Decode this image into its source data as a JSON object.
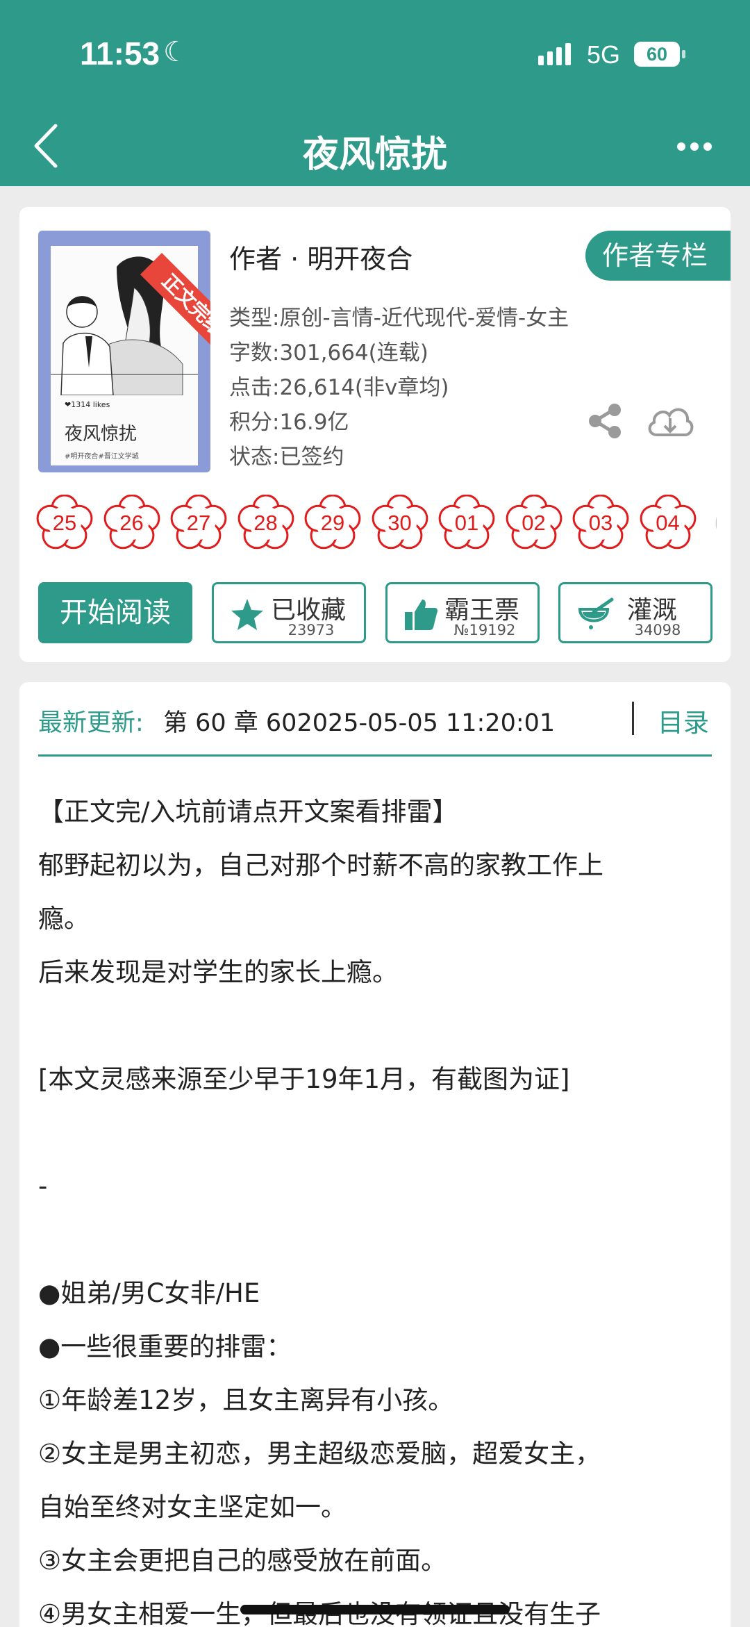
{
  "status_bar": {
    "time": "11:53",
    "network": "5G",
    "battery": "60"
  },
  "nav": {
    "title": "夜风惊扰"
  },
  "book": {
    "cover": {
      "ribbon": "正文完结",
      "title": "夜风惊扰",
      "likes": "❤1314 likes",
      "tags": "#明开夜合#晋江文学城"
    },
    "author": "作者 · 明开夜合",
    "author_column_button": "作者专栏",
    "meta": [
      "类型:原创-言情-近代现代-爱情-女主",
      "字数:301,664(连载)",
      "点击:26,614(非v章均)",
      "积分:16.9亿",
      "状态:已签约"
    ],
    "icons": [
      "share-icon",
      "download-icon"
    ]
  },
  "dates": [
    "25",
    "26",
    "27",
    "28",
    "29",
    "30",
    "01",
    "02",
    "03",
    "04"
  ],
  "actions": {
    "start_reading": "开始阅读",
    "favorite": {
      "label": "已收藏",
      "count": "23973",
      "icon": "star-icon"
    },
    "ticket": {
      "label": "霸王票",
      "count": "№19192",
      "icon": "thumbs-up-icon"
    },
    "irrigate": {
      "label": "灌溉",
      "count": "34098",
      "icon": "watering-icon"
    }
  },
  "update": {
    "label": "最新更新:",
    "value": "第 60 章 602025-05-05 11:20:01",
    "toc": "目录"
  },
  "synopsis": [
    "【正文完/入坑前请点开文案看排雷】",
    "郁野起初以为，自己对那个时薪不高的家教工作上",
    "瘾。",
    "后来发现是对学生的家长上瘾。",
    "",
    "[本文灵感来源至少早于19年1月，有截图为证]",
    "",
    "-",
    "",
    "●姐弟/男C女非/HE",
    "●一些很重要的排雷：",
    "①年龄差12岁，且女主离异有小孩。",
    "②女主是男主初恋，男主超级恋爱脑，超爱女主，",
    "自始至终对女主坚定如一。",
    "③女主会更把自己的感受放在前面。",
    "④男女主相爱一生，但最后也没有领证且没有生子"
  ],
  "colors": {
    "accent": "#2e9b8a",
    "flower": "#e01b1b",
    "ribbon": "#e8463b"
  }
}
